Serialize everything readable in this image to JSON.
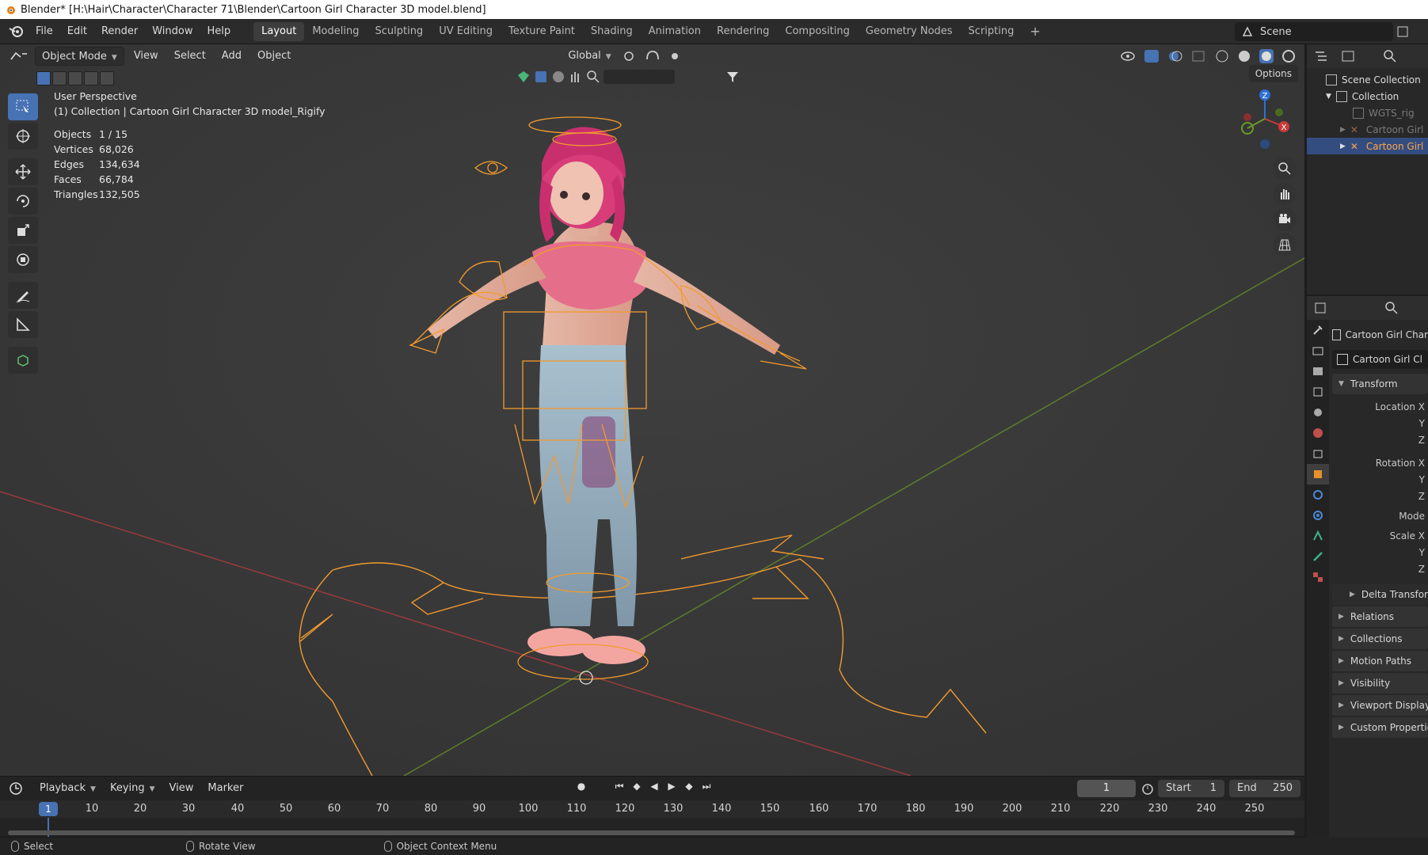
{
  "window": {
    "title": "Blender* [H:\\Hair\\Character\\Character 71\\Blender\\Cartoon Girl Character 3D model.blend]"
  },
  "menu": {
    "items": [
      "File",
      "Edit",
      "Render",
      "Window",
      "Help"
    ]
  },
  "workspaces": [
    "Layout",
    "Modeling",
    "Sculpting",
    "UV Editing",
    "Texture Paint",
    "Shading",
    "Animation",
    "Rendering",
    "Compositing",
    "Geometry Nodes",
    "Scripting"
  ],
  "active_workspace": "Layout",
  "scene": {
    "name": "Scene"
  },
  "viewport": {
    "mode": "Object Mode",
    "menus": [
      "View",
      "Select",
      "Add",
      "Object"
    ],
    "orientation": "Global",
    "options_label": "Options",
    "perspective": "User Perspective",
    "collection_info": "(1) Collection | Cartoon Girl Character 3D model_Rigify",
    "stats": [
      {
        "label": "Objects",
        "value": "1 / 15"
      },
      {
        "label": "Vertices",
        "value": "68,026"
      },
      {
        "label": "Edges",
        "value": "134,634"
      },
      {
        "label": "Faces",
        "value": "66,784"
      },
      {
        "label": "Triangles",
        "value": "132,505"
      }
    ],
    "gizmo_axes": {
      "x": "X",
      "y": "Y",
      "z": "Z"
    }
  },
  "timeline": {
    "menus": [
      "Playback",
      "Keying",
      "View",
      "Marker"
    ],
    "current_frame": "1",
    "start_label": "Start",
    "start_value": "1",
    "end_label": "End",
    "end_value": "250",
    "ruler": [
      "1",
      "10",
      "20",
      "30",
      "40",
      "50",
      "60",
      "70",
      "80",
      "90",
      "100",
      "110",
      "120",
      "130",
      "140",
      "150",
      "160",
      "170",
      "180",
      "190",
      "200",
      "210",
      "220",
      "230",
      "240",
      "250"
    ]
  },
  "statusbar": {
    "select": "Select",
    "rotate": "Rotate View",
    "context": "Object Context Menu"
  },
  "outliner": {
    "items": [
      {
        "label": "Scene Collection",
        "state": "normal"
      },
      {
        "label": "Collection",
        "state": "normal"
      },
      {
        "label": "WGTS_rig",
        "state": "dim"
      },
      {
        "label": "Cartoon Girl",
        "state": "dim"
      },
      {
        "label": "Cartoon Girl",
        "state": "selected"
      }
    ]
  },
  "properties": {
    "object_name": "Cartoon Girl Char",
    "object_field": "Cartoon Girl Cl",
    "transform_header": "Transform",
    "location_labels": [
      "Location X",
      "Y",
      "Z"
    ],
    "rotation_labels": [
      "Rotation X",
      "Y",
      "Z"
    ],
    "mode_label": "Mode",
    "scale_labels": [
      "Scale X",
      "Y",
      "Z"
    ],
    "delta_transform": "Delta Transform",
    "panels": [
      "Relations",
      "Collections",
      "Motion Paths",
      "Visibility",
      "Viewport Display",
      "Custom Properties"
    ]
  },
  "colors": {
    "accent": "#4772b3",
    "selection": "#ffa54a",
    "x_axis": "#c93a3a",
    "y_axis": "#6a9a2a",
    "z_axis": "#2f6fd6"
  }
}
